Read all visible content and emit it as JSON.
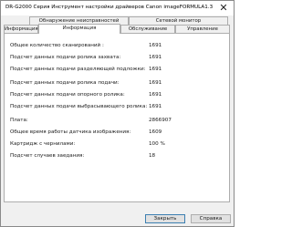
{
  "window": {
    "title": "DR-G2000 Серия Инструмент настройки драйверов Canon imageFORMULA1.3",
    "close_symbol": "✕"
  },
  "tabs": {
    "back_row": [
      "Обнаружение неисправностей",
      "Сетевой монитор"
    ],
    "front_row": [
      "Информация",
      "Информация",
      "Обслуживание",
      "Управление"
    ],
    "active_index": 1
  },
  "info": {
    "rows": [
      {
        "label": "Общее количество сканирований :",
        "value": "1691"
      },
      {
        "label": "Подсчет данных подачи ролика захвата:",
        "value": "1691"
      },
      {
        "label": "Подсчет данных подачи разделяющей подложки:",
        "value": "1691"
      },
      {
        "label": "Подсчет данных подачи ролика подачи:",
        "value": "1691"
      },
      {
        "label": "Подсчет данных подачи опорного ролика:",
        "value": "1691"
      },
      {
        "label": "Подсчет данных подачи выбрасывающего ролика:",
        "value": "1691"
      },
      {
        "label": "Плата:",
        "value": "2866907"
      },
      {
        "label": "Общее время работы датчика изображения:",
        "value": "1609"
      },
      {
        "label": "Картридж с чернилами:",
        "value": "100 %"
      },
      {
        "label": "Подсчет случаев заедания:",
        "value": "18"
      }
    ]
  },
  "footer": {
    "close_label": "Закрыть",
    "help_label": "Справка"
  }
}
